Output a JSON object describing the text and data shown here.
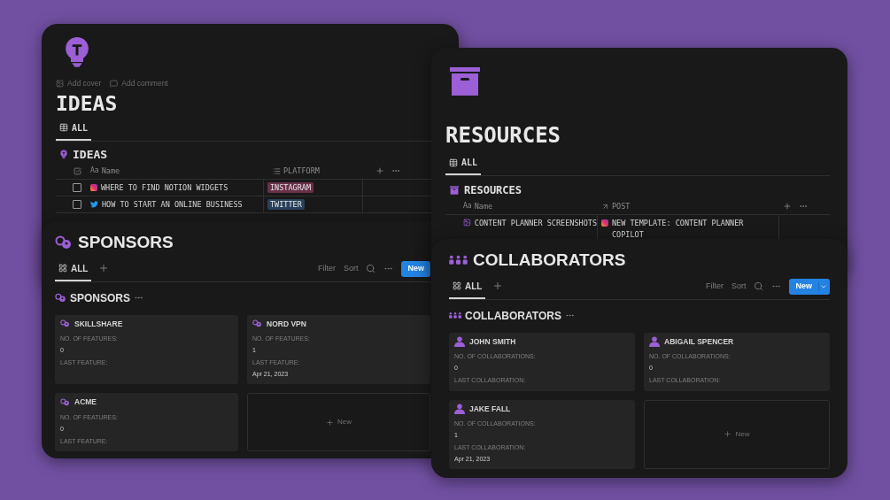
{
  "ideas": {
    "title": "IDEAS",
    "page_actions": [
      "Add cover",
      "Add comment"
    ],
    "views": [
      {
        "label": "ALL",
        "selected": true
      }
    ],
    "database_title": "IDEAS",
    "columns": [
      {
        "type_label": "Aa",
        "label": "Name"
      },
      {
        "label": "PLATFORM"
      }
    ],
    "rows": [
      {
        "checked": false,
        "kind": "instagram",
        "name": "WHERE TO FIND NOTION WIDGETS",
        "platform": {
          "label": "INSTAGRAM",
          "color": "#693049"
        }
      },
      {
        "checked": false,
        "kind": "twitter",
        "name": "HOW TO START AN ONLINE BUSINESS",
        "platform": {
          "label": "TWITTER",
          "color": "#29415c"
        }
      }
    ]
  },
  "resources": {
    "title": "RESOURCES",
    "views": [
      {
        "label": "ALL",
        "selected": true
      }
    ],
    "database_title": "RESOURCES",
    "columns": [
      {
        "type_label": "Aa",
        "label": "Name"
      },
      {
        "label": "POST"
      }
    ],
    "rows": [
      {
        "name": "CONTENT PLANNER SCREENSHOTS",
        "post": "NEW TEMPLATE: CONTENT PLANNER COPILOT"
      }
    ]
  },
  "sponsors": {
    "title": "SPONSORS",
    "views": [
      {
        "label": "ALL",
        "selected": true
      }
    ],
    "toolbar": [
      "Filter",
      "Sort"
    ],
    "new_button": "New",
    "database_title": "SPONSORS",
    "cards": [
      {
        "name": "SKILLSHARE",
        "fields": [
          {
            "label": "NO. OF FEATURES:",
            "value": "0"
          },
          {
            "label": "LAST FEATURE:"
          }
        ]
      },
      {
        "name": "NORD VPN",
        "fields": [
          {
            "label": "NO. OF FEATURES:",
            "value": "1"
          },
          {
            "label": "LAST FEATURE:",
            "value": "Apr 21, 2023"
          }
        ]
      },
      {
        "name": "ACME",
        "fields": [
          {
            "label": "NO. OF FEATURES:",
            "value": "0"
          },
          {
            "label": "LAST FEATURE:"
          }
        ]
      }
    ],
    "new_card": "New"
  },
  "collaborators": {
    "title": "COLLABORATORS",
    "views": [
      {
        "label": "ALL",
        "selected": true
      }
    ],
    "toolbar": [
      "Filter",
      "Sort"
    ],
    "new_button": "New",
    "database_title": "COLLABORATORS",
    "cards": [
      {
        "name": "JOHN SMITH",
        "fields": [
          {
            "label": "NO. OF COLLABORATIONS:",
            "value": "0"
          },
          {
            "label": "LAST COLLABORATION:"
          }
        ]
      },
      {
        "name": "ABIGAIL SPENCER",
        "fields": [
          {
            "label": "NO. OF COLLABORATIONS:",
            "value": "0"
          },
          {
            "label": "LAST COLLABORATION:"
          }
        ]
      },
      {
        "name": "JAKE FALL",
        "fields": [
          {
            "label": "NO. OF COLLABORATIONS:",
            "value": "1"
          },
          {
            "label": "LAST COLLABORATION:",
            "value": "Apr 21, 2023"
          }
        ]
      }
    ],
    "new_card": "New"
  }
}
